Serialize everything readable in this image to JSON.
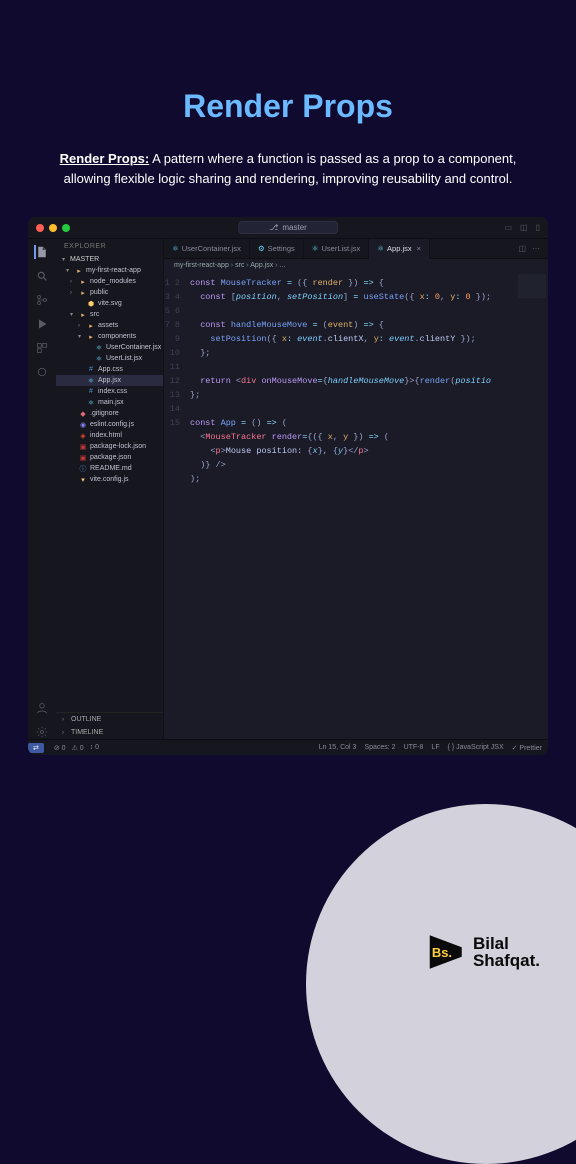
{
  "header": {
    "title": "Render Props",
    "lead": "Render Props:",
    "body": "A pattern where a function is passed as a prop to a component, allowing flexible logic sharing and rendering, improving reusability and control."
  },
  "titlebar": {
    "branch_icon": "›",
    "branch": "master"
  },
  "sidebar": {
    "title": "EXPLORER",
    "section": "MASTER",
    "tree": [
      {
        "depth": 0,
        "kind": "folder-open",
        "label": "my-first-react-app",
        "color": "#c0c4d0"
      },
      {
        "depth": 1,
        "kind": "folder",
        "label": "node_modules",
        "color": "#9aa"
      },
      {
        "depth": 1,
        "kind": "folder",
        "label": "public",
        "color": "#9aa"
      },
      {
        "depth": 2,
        "kind": "file",
        "label": "vite.svg",
        "icon": "⬢",
        "iconColor": "#ffcb6b"
      },
      {
        "depth": 1,
        "kind": "folder-open",
        "label": "src",
        "color": "#c0c4d0"
      },
      {
        "depth": 2,
        "kind": "folder",
        "label": "assets",
        "color": "#9aa"
      },
      {
        "depth": 2,
        "kind": "folder-open",
        "label": "components",
        "color": "#c0c4d0"
      },
      {
        "depth": 3,
        "kind": "file",
        "label": "UserContainer.jsx",
        "icon": "⚛",
        "iconColor": "#61dafb"
      },
      {
        "depth": 3,
        "kind": "file",
        "label": "UserList.jsx",
        "icon": "⚛",
        "iconColor": "#61dafb"
      },
      {
        "depth": 2,
        "kind": "file",
        "label": "App.css",
        "icon": "#",
        "iconColor": "#5090d0"
      },
      {
        "depth": 2,
        "kind": "file",
        "label": "App.jsx",
        "icon": "⚛",
        "iconColor": "#61dafb",
        "selected": true
      },
      {
        "depth": 2,
        "kind": "file",
        "label": "index.css",
        "icon": "#",
        "iconColor": "#5090d0"
      },
      {
        "depth": 2,
        "kind": "file",
        "label": "main.jsx",
        "icon": "⚛",
        "iconColor": "#61dafb"
      },
      {
        "depth": 1,
        "kind": "file",
        "label": ".gitignore",
        "icon": "◆",
        "iconColor": "#e06c75"
      },
      {
        "depth": 1,
        "kind": "file",
        "label": "eslint.config.js",
        "icon": "◉",
        "iconColor": "#8080f0"
      },
      {
        "depth": 1,
        "kind": "file",
        "label": "index.html",
        "icon": "◈",
        "iconColor": "#e44d26"
      },
      {
        "depth": 1,
        "kind": "file",
        "label": "package-lock.json",
        "icon": "▣",
        "iconColor": "#cb3837"
      },
      {
        "depth": 1,
        "kind": "file",
        "label": "package.json",
        "icon": "▣",
        "iconColor": "#cb3837"
      },
      {
        "depth": 1,
        "kind": "file",
        "label": "README.md",
        "icon": "ⓘ",
        "iconColor": "#5090d0"
      },
      {
        "depth": 1,
        "kind": "file",
        "label": "vite.config.js",
        "icon": "▾",
        "iconColor": "#ffcb6b"
      }
    ],
    "bottom": [
      "OUTLINE",
      "TIMELINE"
    ]
  },
  "tabs": [
    {
      "label": "UserContainer.jsx",
      "icon": "⚛",
      "active": false
    },
    {
      "label": "Settings",
      "icon": "⚙",
      "active": false
    },
    {
      "label": "UserList.jsx",
      "icon": "⚛",
      "active": false
    },
    {
      "label": "App.jsx",
      "icon": "⚛",
      "active": true
    }
  ],
  "breadcrumbs": [
    "my-first-react-app",
    "src",
    "App.jsx",
    "..."
  ],
  "code": {
    "lines": [
      [
        [
          "c-kw",
          "const "
        ],
        [
          "c-fn",
          "MouseTracker"
        ],
        [
          "c-plain",
          " "
        ],
        [
          "c-op",
          "="
        ],
        [
          "c-plain",
          " "
        ],
        [
          "c-punc",
          "({ "
        ],
        [
          "c-param",
          "render"
        ],
        [
          "c-punc",
          " }) "
        ],
        [
          "c-op",
          "=>"
        ],
        [
          "c-punc",
          " {"
        ]
      ],
      [
        [
          "",
          "  "
        ],
        [
          "c-kw",
          "const "
        ],
        [
          "c-punc",
          "["
        ],
        [
          "c-var",
          "position"
        ],
        [
          "c-punc",
          ", "
        ],
        [
          "c-var",
          "setPosition"
        ],
        [
          "c-punc",
          "] "
        ],
        [
          "c-op",
          "="
        ],
        [
          "c-plain",
          " "
        ],
        [
          "c-fn",
          "useState"
        ],
        [
          "c-punc",
          "({ "
        ],
        [
          "c-param",
          "x"
        ],
        [
          "c-op",
          ": "
        ],
        [
          "c-num",
          "0"
        ],
        [
          "c-punc",
          ", "
        ],
        [
          "c-param",
          "y"
        ],
        [
          "c-op",
          ": "
        ],
        [
          "c-num",
          "0"
        ],
        [
          "c-punc",
          " });"
        ]
      ],
      [
        [
          "",
          ""
        ]
      ],
      [
        [
          "",
          "  "
        ],
        [
          "c-kw",
          "const "
        ],
        [
          "c-fn",
          "handleMouseMove"
        ],
        [
          "c-plain",
          " "
        ],
        [
          "c-op",
          "="
        ],
        [
          "c-plain",
          " "
        ],
        [
          "c-punc",
          "("
        ],
        [
          "c-param",
          "event"
        ],
        [
          "c-punc",
          ") "
        ],
        [
          "c-op",
          "=>"
        ],
        [
          "c-punc",
          " {"
        ]
      ],
      [
        [
          "",
          "    "
        ],
        [
          "c-fn",
          "setPosition"
        ],
        [
          "c-punc",
          "({ "
        ],
        [
          "c-param",
          "x"
        ],
        [
          "c-op",
          ": "
        ],
        [
          "c-var",
          "event"
        ],
        [
          "c-punc",
          "."
        ],
        [
          "c-plain",
          "clientX"
        ],
        [
          "c-punc",
          ", "
        ],
        [
          "c-param",
          "y"
        ],
        [
          "c-op",
          ": "
        ],
        [
          "c-var",
          "event"
        ],
        [
          "c-punc",
          "."
        ],
        [
          "c-plain",
          "clientY"
        ],
        [
          "c-punc",
          " });"
        ]
      ],
      [
        [
          "",
          "  "
        ],
        [
          "c-punc",
          "};"
        ]
      ],
      [
        [
          "",
          ""
        ]
      ],
      [
        [
          "",
          "  "
        ],
        [
          "c-kw",
          "return "
        ],
        [
          "c-punc",
          "<"
        ],
        [
          "c-tag",
          "div "
        ],
        [
          "c-attr",
          "onMouseMove"
        ],
        [
          "c-op",
          "="
        ],
        [
          "c-punc",
          "{"
        ],
        [
          "c-var",
          "handleMouseMove"
        ],
        [
          "c-punc",
          "}>{"
        ],
        [
          "c-fn",
          "render"
        ],
        [
          "c-punc",
          "("
        ],
        [
          "c-var",
          "positio"
        ]
      ],
      [
        [
          "c-punc",
          "};"
        ]
      ],
      [
        [
          "",
          ""
        ]
      ],
      [
        [
          "c-kw",
          "const "
        ],
        [
          "c-fn",
          "App"
        ],
        [
          "c-plain",
          " "
        ],
        [
          "c-op",
          "="
        ],
        [
          "c-plain",
          " "
        ],
        [
          "c-punc",
          "() "
        ],
        [
          "c-op",
          "=>"
        ],
        [
          "c-punc",
          " ("
        ]
      ],
      [
        [
          "",
          "  "
        ],
        [
          "c-punc",
          "<"
        ],
        [
          "c-tag",
          "MouseTracker "
        ],
        [
          "c-attr",
          "render"
        ],
        [
          "c-op",
          "="
        ],
        [
          "c-punc",
          "{({ "
        ],
        [
          "c-param",
          "x"
        ],
        [
          "c-punc",
          ", "
        ],
        [
          "c-param",
          "y"
        ],
        [
          "c-punc",
          " }) "
        ],
        [
          "c-op",
          "=>"
        ],
        [
          "c-punc",
          " ("
        ]
      ],
      [
        [
          "",
          "    "
        ],
        [
          "c-punc",
          "<"
        ],
        [
          "c-tag",
          "p"
        ],
        [
          "c-punc",
          ">"
        ],
        [
          "c-plain",
          "Mouse position: "
        ],
        [
          "c-punc",
          "{"
        ],
        [
          "c-var",
          "x"
        ],
        [
          "c-punc",
          "}, {"
        ],
        [
          "c-var",
          "y"
        ],
        [
          "c-punc",
          "}</"
        ],
        [
          "c-tag",
          "p"
        ],
        [
          "c-punc",
          ">"
        ]
      ],
      [
        [
          "",
          "  "
        ],
        [
          "c-punc",
          ")} />"
        ]
      ],
      [
        [
          "c-punc",
          ");"
        ]
      ]
    ]
  },
  "statusbar": {
    "left": [
      "⊘ 0",
      "⚠ 0",
      "↕ 0"
    ],
    "right": [
      "Ln 15, Col 3",
      "Spaces: 2",
      "UTF-8",
      "LF",
      "{ } JavaScript JSX",
      "✓ Prettier"
    ]
  },
  "brand": {
    "logo": "Bs.",
    "line1": "Bilal",
    "line2": "Shafqat."
  }
}
